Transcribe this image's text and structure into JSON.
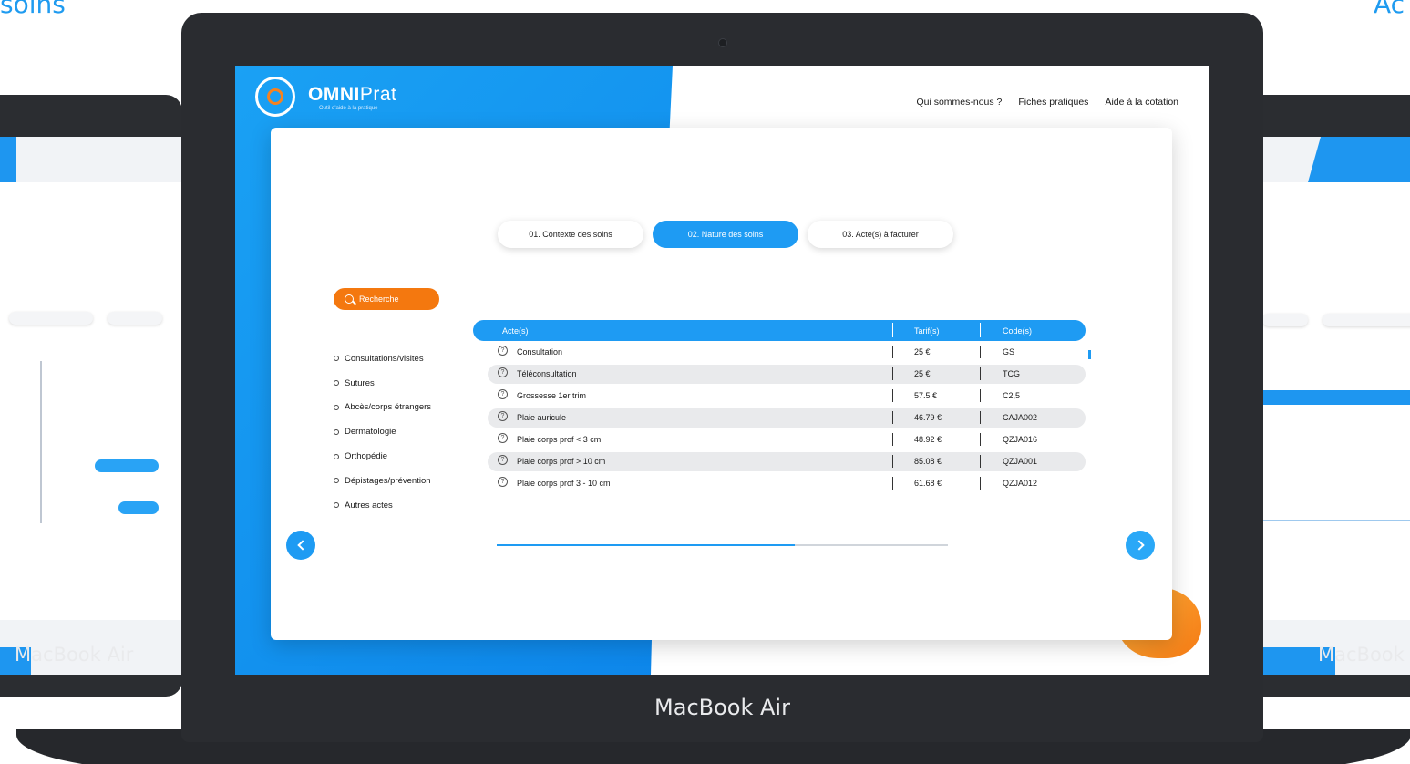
{
  "edge_captions": {
    "left": "soins",
    "right": "Ac"
  },
  "device_label": "MacBook Air",
  "app": {
    "brand_strong": "OMNI",
    "brand_light": "Prat",
    "tagline": "Outil d'aide à la pratique"
  },
  "nav": [
    "Qui sommes-nous ?",
    "Fiches pratiques",
    "Aide à la cotation"
  ],
  "steps": [
    {
      "label": "01. Contexte des soins",
      "active": false
    },
    {
      "label": "02. Nature des soins",
      "active": true
    },
    {
      "label": "03. Acte(s) à facturer",
      "active": false
    }
  ],
  "search_label": "Recherche",
  "categories": [
    "Consultations/visites",
    "Sutures",
    "Abcès/corps étrangers",
    "Dermatologie",
    "Orthopédie",
    "Dépistages/prévention",
    "Autres actes"
  ],
  "table": {
    "headers": {
      "act": "Acte(s)",
      "price": "Tarif(s)",
      "code": "Code(s)"
    },
    "rows": [
      {
        "act": "Consultation",
        "price": "25 €",
        "code": "GS"
      },
      {
        "act": "Téléconsultation",
        "price": "25 €",
        "code": "TCG"
      },
      {
        "act": "Grossesse 1er trim",
        "price": "57.5 €",
        "code": "C2,5"
      },
      {
        "act": "Plaie auricule",
        "price": "46.79 €",
        "code": "CAJA002"
      },
      {
        "act": "Plaie corps prof < 3 cm",
        "price": "48.92 €",
        "code": "QZJA016"
      },
      {
        "act": "Plaie corps prof > 10 cm",
        "price": "85.08 €",
        "code": "QZJA001"
      },
      {
        "act": "Plaie corps prof 3 - 10 cm",
        "price": "61.68 €",
        "code": "QZJA012"
      }
    ],
    "help_icon": "help-circle-icon"
  },
  "progress": 0.66,
  "colors": {
    "primary": "#1e9bf3",
    "accent": "#f4780f"
  },
  "icons": {
    "search": "search-icon",
    "prev": "chevron-left-icon",
    "next": "chevron-right-icon"
  }
}
